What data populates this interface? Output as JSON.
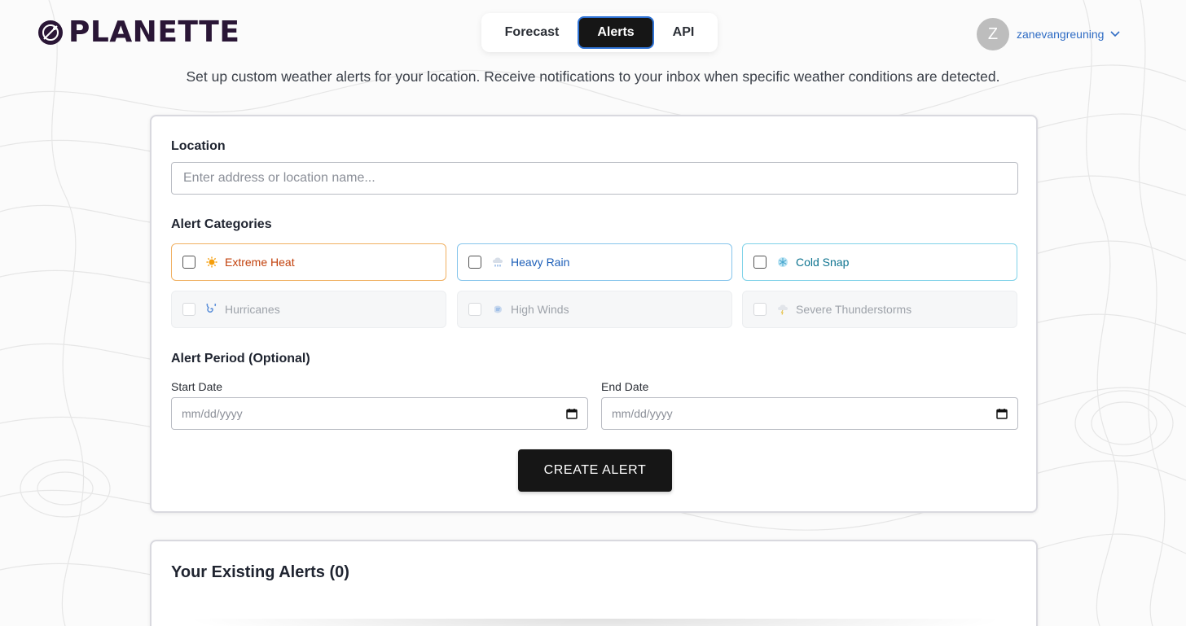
{
  "brand": {
    "name": "PLANETTE"
  },
  "nav": {
    "tabs": [
      {
        "label": "Forecast",
        "active": false
      },
      {
        "label": "Alerts",
        "active": true
      },
      {
        "label": "API",
        "active": false
      }
    ]
  },
  "user": {
    "initial": "Z",
    "username": "zanevangreuning"
  },
  "intro": "Set up custom weather alerts for your location. Receive notifications to your inbox when specific weather conditions are detected.",
  "form": {
    "location_label": "Location",
    "location_placeholder": "Enter address or location name...",
    "location_value": "",
    "categories_label": "Alert Categories",
    "categories": [
      {
        "label": "Extreme Heat",
        "icon": "sun-icon",
        "enabled": true,
        "checked": false,
        "color": "#c2410c"
      },
      {
        "label": "Heavy Rain",
        "icon": "rain-cloud-icon",
        "enabled": true,
        "checked": false,
        "color": "#1d5fb8"
      },
      {
        "label": "Cold Snap",
        "icon": "snowflake-icon",
        "enabled": true,
        "checked": false,
        "color": "#0e7490"
      },
      {
        "label": "Hurricanes",
        "icon": "cyclone-icon",
        "enabled": false,
        "checked": false
      },
      {
        "label": "High Winds",
        "icon": "wind-face-icon",
        "enabled": false,
        "checked": false
      },
      {
        "label": "Severe Thunderstorms",
        "icon": "thunder-cloud-icon",
        "enabled": false,
        "checked": false
      }
    ],
    "period_label": "Alert Period (Optional)",
    "start_label": "Start Date",
    "start_placeholder": "mm/dd/yyyy",
    "end_label": "End Date",
    "end_placeholder": "mm/dd/yyyy",
    "submit_label": "CREATE ALERT"
  },
  "existing": {
    "title": "Your Existing Alerts (0)"
  }
}
